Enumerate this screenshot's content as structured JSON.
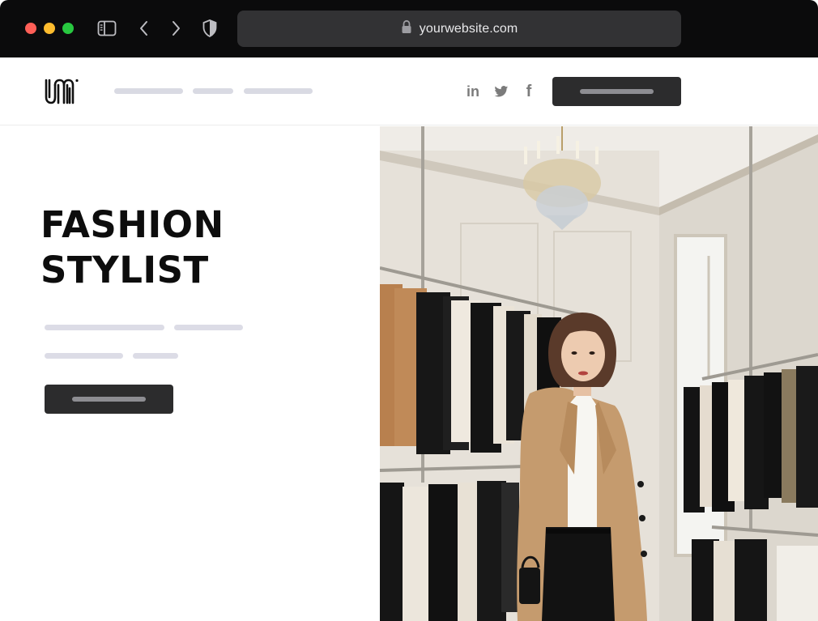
{
  "browser": {
    "url": "yourwebsite.com",
    "icons": [
      "sidebar-icon",
      "back-icon",
      "forward-icon",
      "shield-icon",
      "lock-icon"
    ],
    "traffic_lights": [
      "#ff5f57",
      "#febc2e",
      "#28c840"
    ]
  },
  "header": {
    "logo": "logo",
    "nav_placeholder_count": 3,
    "social": [
      {
        "name": "linkedin-icon",
        "glyph": "in"
      },
      {
        "name": "twitter-icon",
        "glyph": ""
      },
      {
        "name": "facebook-icon",
        "glyph": "f"
      }
    ],
    "cta_placeholder": true
  },
  "hero": {
    "title_line1": "FASHION",
    "title_line2": "STYLIST",
    "cta_placeholder": true
  },
  "colors": {
    "chrome_bg": "#0b0b0c",
    "address_bar": "#323234",
    "button_bg": "#2c2c2d",
    "placeholder_line": "#d9dae3",
    "title_text": "#0d0d0d"
  }
}
